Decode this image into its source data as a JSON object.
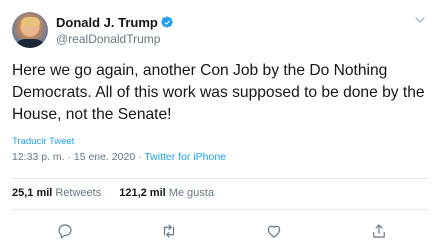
{
  "tweet": {
    "author_name": "Donald J. Trump",
    "author_handle": "@realDonaldTrump",
    "text": "Here we go again, another Con Job by the Do Nothing Democrats. All of this work was supposed to be done by the House, not the Senate!",
    "translate_label": "Traducir Tweet",
    "timestamp": "12:33 p. m. · 15 ene. 2020 · ",
    "source": "Twitter for iPhone"
  },
  "stats": {
    "retweets_count": "25,1 mil",
    "retweets_label": "Retweets",
    "likes_count": "121,2 mil",
    "likes_label": "Me gusta"
  },
  "icons": {
    "verified": "verified-badge-icon",
    "menu": "chevron-down-icon",
    "reply": "reply-icon",
    "retweet": "retweet-icon",
    "like": "heart-icon",
    "share": "share-icon"
  },
  "colors": {
    "accent": "#1da1f2",
    "secondary_text": "#657786",
    "primary_text": "#14171a",
    "divider": "#e1e8ed"
  }
}
